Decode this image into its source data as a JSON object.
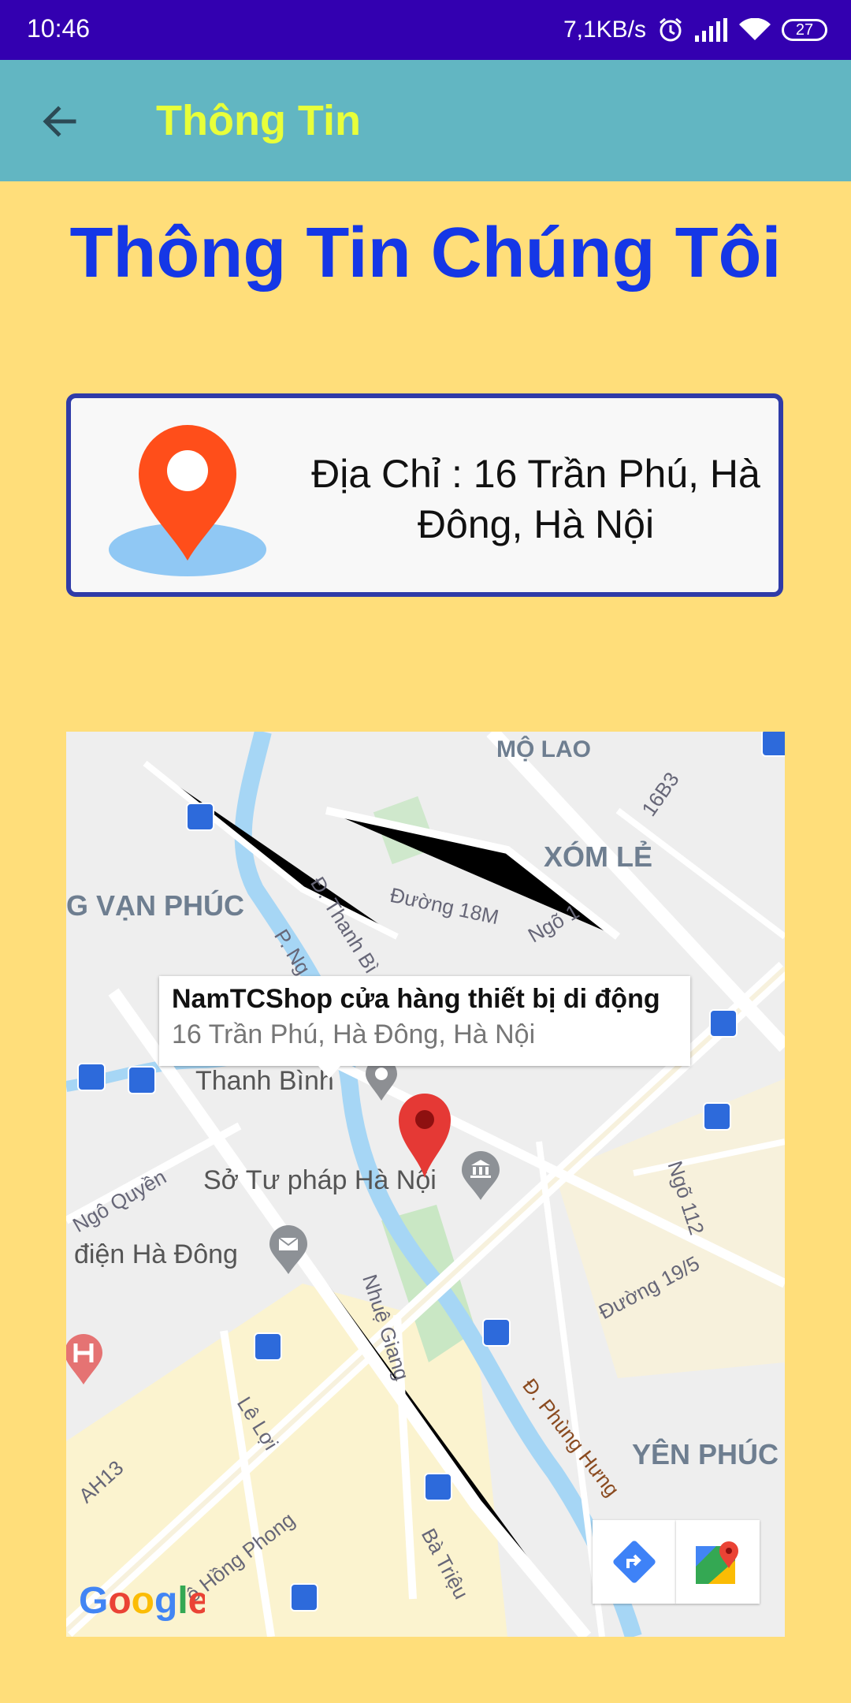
{
  "status_bar": {
    "time": "10:46",
    "speed": "7,1KB/s",
    "battery": "27"
  },
  "app_bar": {
    "title": "Thông Tin"
  },
  "page": {
    "heading": "Thông Tin Chúng Tôi"
  },
  "address_card": {
    "text": "Địa Chỉ : 16 Trần Phú, Hà Đông, Hà Nội"
  },
  "map": {
    "info_title": "NamTCShop cửa hàng thiết bị di động",
    "info_address": "16 Trần Phú, Hà Đông, Hà Nội",
    "labels": {
      "mo_lao": "MỘ LAO",
      "xom_le": "XÓM LẺ",
      "van_phuc": "G VẠN PHÚC",
      "yen_phuc": "YÊN PHÚC",
      "thanh_binh": "Thanh Bình",
      "so_tu_phap": "Sở Tư pháp Hà Nội",
      "buu_dien": "điện Hà Đông",
      "duong_18m": "Đường 18M",
      "ngo_1": "Ngõ 1",
      "road_16b3": "16B3",
      "d_thanh_binh": "Đ. Thanh Bì",
      "p_ng": "P. Ng",
      "ngo_quyen": "Ngô Quyền",
      "nhue_giang": "Nhuệ Giang",
      "ngo_112": "Ngõ 112",
      "duong_19_5": "Đường 19/5",
      "le_loi": "Lê Lợi",
      "ah13": "AH13",
      "phung_hung": "Đ. Phùng Hưng",
      "le_hong_phong": "ê Hồng Phong",
      "ba_trieu": "Bà Triệu"
    },
    "google_logo": "Google"
  }
}
